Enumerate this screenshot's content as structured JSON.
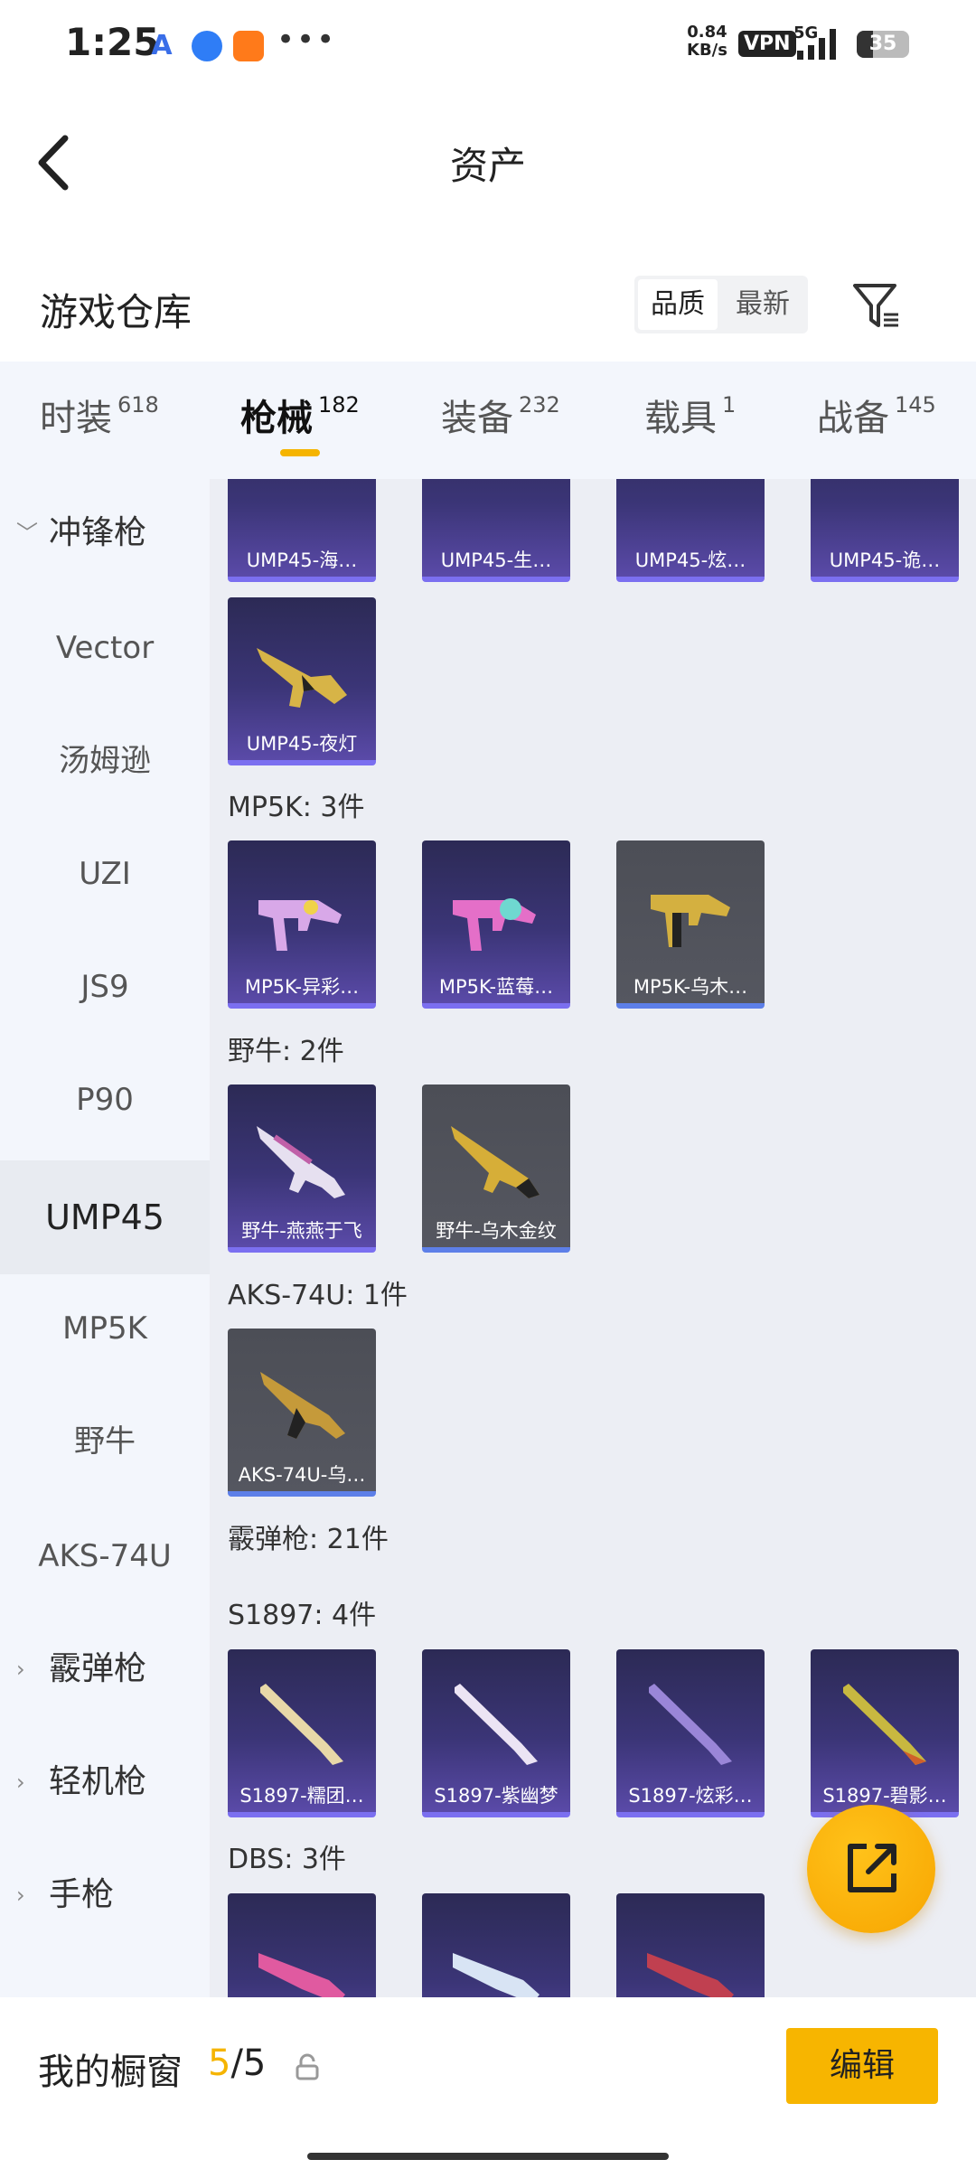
{
  "status_bar": {
    "time": "1:25",
    "app_icons": [
      "a-app-icon",
      "browser-icon",
      "shopping-icon"
    ],
    "more": "•••",
    "net_speed_value": "0.84",
    "net_speed_unit": "KB/s",
    "vpn": "VPN",
    "network": "5G",
    "battery": "35"
  },
  "header": {
    "title": "资产"
  },
  "warehouse": {
    "title": "游戏仓库",
    "sort_options": [
      "品质",
      "最新"
    ],
    "active_sort": "品质"
  },
  "tabs": [
    {
      "label": "时装",
      "count": "618"
    },
    {
      "label": "枪械",
      "count": "182",
      "active": true
    },
    {
      "label": "装备",
      "count": "232"
    },
    {
      "label": "载具",
      "count": "1"
    },
    {
      "label": "战备",
      "count": "145"
    }
  ],
  "sidebar": {
    "items": [
      {
        "label": "冲锋枪",
        "type": "category",
        "expanded": true
      },
      {
        "label": "Vector"
      },
      {
        "label": "汤姆逊"
      },
      {
        "label": "UZI"
      },
      {
        "label": "JS9"
      },
      {
        "label": "P90"
      },
      {
        "label": "UMP45",
        "active": true
      },
      {
        "label": "MP5K"
      },
      {
        "label": "野牛"
      },
      {
        "label": "AKS-74U"
      },
      {
        "label": "霰弹枪",
        "type": "category"
      },
      {
        "label": "轻机枪",
        "type": "category"
      },
      {
        "label": "手枪",
        "type": "category"
      }
    ]
  },
  "content": {
    "ump45_top_row": [
      "UMP45-海…",
      "UMP45-生…",
      "UMP45-炫…",
      "UMP45-诡…"
    ],
    "ump45_more": [
      "UMP45-夜灯"
    ],
    "sections": [
      {
        "title": "MP5K: 3件",
        "items": [
          "MP5K-异彩…",
          "MP5K-蓝莓…",
          "MP5K-乌木…"
        ]
      },
      {
        "title": "野牛: 2件",
        "items": [
          "野牛-燕燕于飞",
          "野牛-乌木金纹"
        ]
      },
      {
        "title": "AKS-74U: 1件",
        "items": [
          "AKS-74U-乌…"
        ]
      },
      {
        "title": "霰弹枪: 21件"
      },
      {
        "title": "S1897: 4件",
        "items": [
          "S1897-糯团…",
          "S1897-紫幽梦",
          "S1897-炫彩…",
          "S1897-碧影…"
        ]
      },
      {
        "title": "DBS: 3件"
      }
    ]
  },
  "bottom_bar": {
    "window_label": "我的橱窗",
    "window_used": "5",
    "window_total": "/5",
    "edit_label": "编辑"
  }
}
